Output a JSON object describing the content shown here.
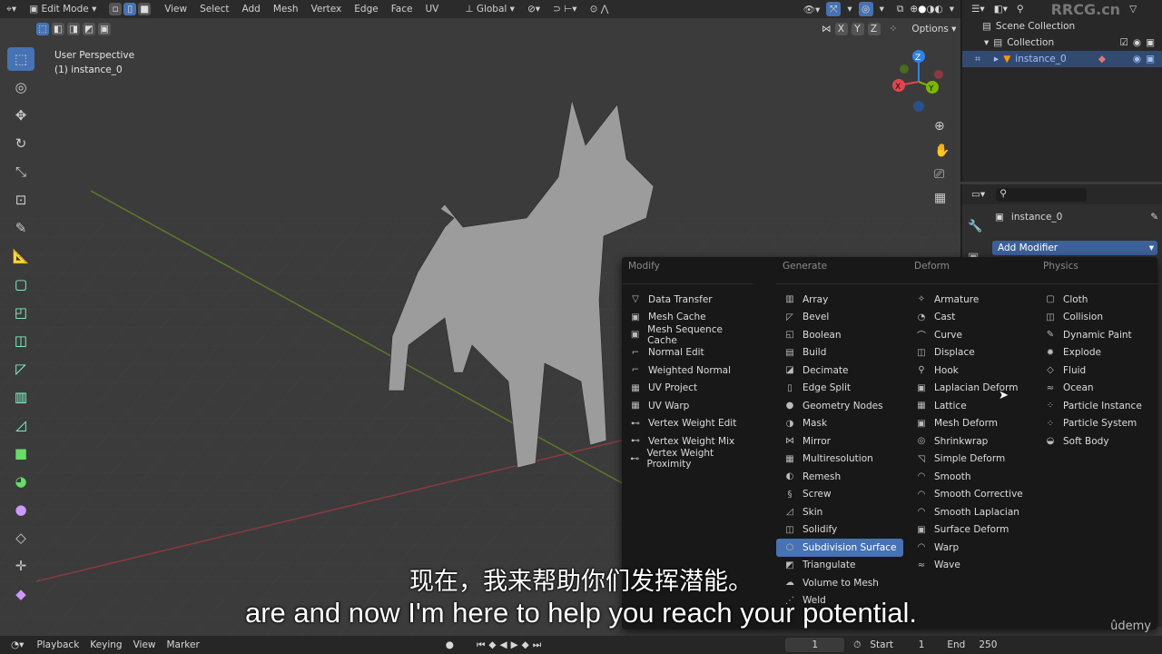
{
  "header": {
    "mode": "Edit Mode",
    "menus": [
      "View",
      "Select",
      "Add",
      "Mesh",
      "Vertex",
      "Edge",
      "Face",
      "UV"
    ],
    "orientation": "Global",
    "axes": [
      "X",
      "Y",
      "Z"
    ],
    "options": "Options"
  },
  "viewport": {
    "perspective": "User Perspective",
    "object": "(1) instance_0",
    "gizmo": {
      "z": "Z",
      "y": "Y",
      "x": "X"
    }
  },
  "outliner": {
    "watermark": "RRCG.cn",
    "items": [
      "Scene Collection",
      "Collection",
      "instance_0"
    ]
  },
  "properties": {
    "object": "instance_0",
    "add_modifier": "Add Modifier"
  },
  "menu": {
    "columns": [
      {
        "title": "Modify",
        "items": [
          [
            "Data Transfer",
            "▽"
          ],
          [
            "Mesh Cache",
            "▣"
          ],
          [
            "Mesh Sequence Cache",
            "▣"
          ],
          [
            "Normal Edit",
            "⌐"
          ],
          [
            "Weighted Normal",
            "⌐"
          ],
          [
            "UV Project",
            "▦"
          ],
          [
            "UV Warp",
            "▦"
          ],
          [
            "Vertex Weight Edit",
            "⊷"
          ],
          [
            "Vertex Weight Mix",
            "⊷"
          ],
          [
            "Vertex Weight Proximity",
            "⊷"
          ]
        ]
      },
      {
        "title": "Generate",
        "items": [
          [
            "Array",
            "▥"
          ],
          [
            "Bevel",
            "◸"
          ],
          [
            "Boolean",
            "◱"
          ],
          [
            "Build",
            "▤"
          ],
          [
            "Decimate",
            "◪"
          ],
          [
            "Edge Split",
            "▯"
          ],
          [
            "Geometry Nodes",
            "●"
          ],
          [
            "Mask",
            "◑"
          ],
          [
            "Mirror",
            "⋈"
          ],
          [
            "Multiresolution",
            "▦"
          ],
          [
            "Remesh",
            "◐"
          ],
          [
            "Screw",
            "§"
          ],
          [
            "Skin",
            "◿"
          ],
          [
            "Solidify",
            "◫"
          ],
          [
            "Subdivision Surface",
            "○"
          ],
          [
            "Triangulate",
            "◩"
          ],
          [
            "Volume to Mesh",
            "☁"
          ],
          [
            "Weld",
            "⋰"
          ]
        ]
      },
      {
        "title": "Deform",
        "items": [
          [
            "Armature",
            "✧"
          ],
          [
            "Cast",
            "◔"
          ],
          [
            "Curve",
            "⌒"
          ],
          [
            "Displace",
            "◫"
          ],
          [
            "Hook",
            "⚲"
          ],
          [
            "Laplacian Deform",
            "▣"
          ],
          [
            "Lattice",
            "▦"
          ],
          [
            "Mesh Deform",
            "▣"
          ],
          [
            "Shrinkwrap",
            "◎"
          ],
          [
            "Simple Deform",
            "◹"
          ],
          [
            "Smooth",
            "◠"
          ],
          [
            "Smooth Corrective",
            "◠"
          ],
          [
            "Smooth Laplacian",
            "◠"
          ],
          [
            "Surface Deform",
            "▣"
          ],
          [
            "Warp",
            "◠"
          ],
          [
            "Wave",
            "≈"
          ]
        ]
      },
      {
        "title": "Physics",
        "items": [
          [
            "Cloth",
            "▢"
          ],
          [
            "Collision",
            "◫"
          ],
          [
            "Dynamic Paint",
            "✎"
          ],
          [
            "Explode",
            "✹"
          ],
          [
            "Fluid",
            "◇"
          ],
          [
            "Ocean",
            "≈"
          ],
          [
            "Particle Instance",
            "⁘"
          ],
          [
            "Particle System",
            "⁘"
          ],
          [
            "Soft Body",
            "◒"
          ]
        ]
      }
    ],
    "highlighted": "Subdivision Surface"
  },
  "timeline": {
    "menus": [
      "Playback",
      "Keying",
      "View",
      "Marker"
    ],
    "frame": "1",
    "start_label": "Start",
    "start": "1",
    "end_label": "End",
    "end": "250",
    "brand": "ûdemy"
  },
  "subtitles": {
    "zh": "现在，我来帮助你们发挥潜能。",
    "en": "are and now I'm here to help you reach your potential."
  },
  "colors": {
    "accent": "#4772b3",
    "x_axis": "#e0464e",
    "y_axis": "#7ab800",
    "z_axis": "#2f84e3"
  }
}
